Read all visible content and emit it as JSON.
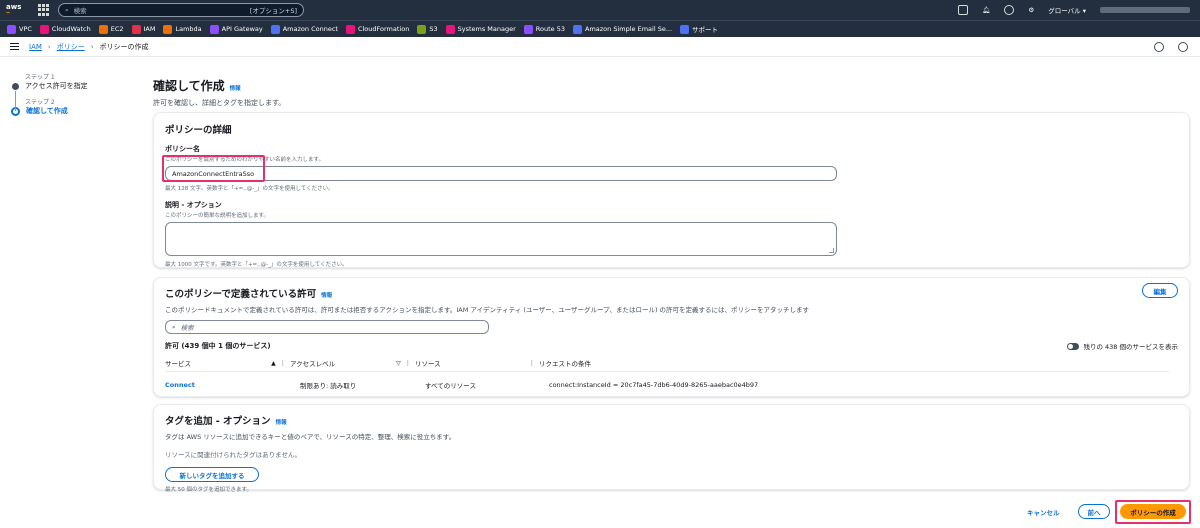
{
  "topnav": {
    "logo_text": "aws",
    "search_placeholder": "検索",
    "search_shortcut": "[オプション+S]",
    "region": "グローバル ▾"
  },
  "favorites": [
    {
      "label": "VPC",
      "color": "#8c4fff"
    },
    {
      "label": "CloudWatch",
      "color": "#e7157b"
    },
    {
      "label": "EC2",
      "color": "#ed7100"
    },
    {
      "label": "IAM",
      "color": "#dd344c"
    },
    {
      "label": "Lambda",
      "color": "#ed7100"
    },
    {
      "label": "API Gateway",
      "color": "#8c4fff"
    },
    {
      "label": "Amazon Connect",
      "color": "#4d72f3"
    },
    {
      "label": "CloudFormation",
      "color": "#e7157b"
    },
    {
      "label": "S3",
      "color": "#7aa116"
    },
    {
      "label": "Systems Manager",
      "color": "#e7157b"
    },
    {
      "label": "Route 53",
      "color": "#8c4fff"
    },
    {
      "label": "Amazon Simple Email Se...",
      "color": "#4d72f3"
    },
    {
      "label": "サポート",
      "color": "#4d72f3"
    }
  ],
  "breadcrumb": {
    "items": [
      "IAM",
      "ポリシー"
    ],
    "current": "ポリシーの作成"
  },
  "steps": {
    "step1_small": "ステップ 1",
    "step1_label": "アクセス許可を指定",
    "step2_small": "ステップ 2",
    "step2_label": "確認して作成"
  },
  "page": {
    "title": "確認して作成",
    "info": "情報",
    "description": "許可を確認し、詳細とタグを指定します。"
  },
  "details": {
    "heading": "ポリシーの詳細",
    "name_label": "ポリシー名",
    "name_hint": "このポリシーを識別するためのわかりやすい名前を入力します。",
    "name_value": "AmazonConnectEntraSso",
    "name_constraint": "最大 128 文字。英数字と「+=,.@-_」の文字を使用してください。",
    "desc_label": "説明 - オプション",
    "desc_hint": "このポリシーの簡単な説明を追加します。",
    "desc_constraint": "最大 1000 文字です。英数字と「+=,.@-_」の文字を使用してください。"
  },
  "permissions": {
    "heading": "このポリシーで定義されている許可",
    "info": "情報",
    "description": "このポリシードキュメントで定義されている許可は、許可または拒否するアクションを指定します。IAM アイデンティティ (ユーザー、ユーザーグループ、またはロール) の許可を定義するには、ポリシーをアタッチします",
    "edit_label": "編集",
    "search_placeholder": "検索",
    "count_label": "許可 (439 個中 1 個のサービス)",
    "toggle_label": "残りの 438 個のサービスを表示",
    "columns": [
      "サービス",
      "アクセスレベル",
      "リソース",
      "リクエストの条件"
    ],
    "rows": [
      {
        "service": "Connect",
        "access": "制限あり: 読み取り",
        "resource": "すべてのリソース",
        "condition": "connect:InstanceId = 20c7fa45-7db6-40d9-8265-aaebac0e4b97"
      }
    ]
  },
  "tags": {
    "heading": "タグを追加 - オプション",
    "info": "情報",
    "description": "タグは AWS リソースに追加できるキーと値のペアで、リソースの特定、整理、検索に役立ちます。",
    "empty": "リソースに関連付けられたタグはありません。",
    "add_label": "新しいタグを追加する",
    "limit": "最大 50 個のタグを追加できます。"
  },
  "footer": {
    "cancel": "キャンセル",
    "previous": "前へ",
    "create": "ポリシーの作成"
  }
}
